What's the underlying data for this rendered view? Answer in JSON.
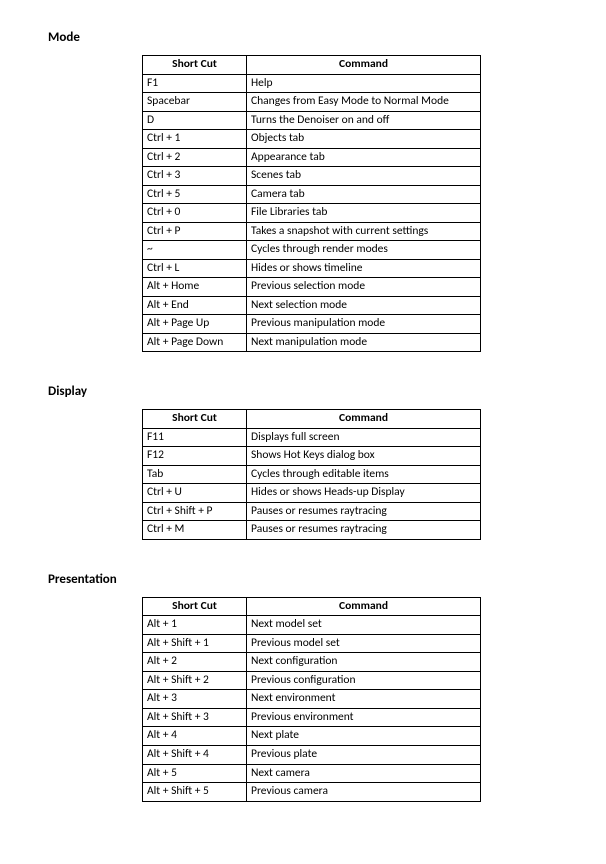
{
  "sections": [
    {
      "title": "Mode",
      "headers": {
        "shortcut": "Short Cut",
        "command": "Command"
      },
      "rows": [
        {
          "shortcut": "F1",
          "command": "Help"
        },
        {
          "shortcut": "Spacebar",
          "command": "Changes from Easy Mode to Normal Mode"
        },
        {
          "shortcut": "D",
          "command": "Turns the Denoiser on and off"
        },
        {
          "shortcut": "Ctrl + 1",
          "command": "Objects tab"
        },
        {
          "shortcut": "Ctrl + 2",
          "command": "Appearance tab"
        },
        {
          "shortcut": "Ctrl + 3",
          "command": "Scenes tab"
        },
        {
          "shortcut": "Ctrl + 5",
          "command": "Camera tab"
        },
        {
          "shortcut": "Ctrl + 0",
          "command": "File Libraries tab"
        },
        {
          "shortcut": "Ctrl + P",
          "command": "Takes a snapshot with current settings"
        },
        {
          "shortcut": "~",
          "command": "Cycles through render modes"
        },
        {
          "shortcut": "Ctrl + L",
          "command": "Hides or shows timeline"
        },
        {
          "shortcut": "Alt + Home",
          "command": "Previous selection mode"
        },
        {
          "shortcut": "Alt + End",
          "command": "Next selection mode"
        },
        {
          "shortcut": "Alt + Page Up",
          "command": "Previous manipulation mode"
        },
        {
          "shortcut": "Alt + Page Down",
          "command": "Next manipulation mode"
        }
      ]
    },
    {
      "title": "Display",
      "headers": {
        "shortcut": "Short Cut",
        "command": "Command"
      },
      "rows": [
        {
          "shortcut": "F11",
          "command": "Displays full screen"
        },
        {
          "shortcut": "F12",
          "command": "Shows Hot Keys dialog box"
        },
        {
          "shortcut": "Tab",
          "command": "Cycles through editable items"
        },
        {
          "shortcut": "Ctrl + U",
          "command": "Hides or shows Heads-up Display"
        },
        {
          "shortcut": "Ctrl + Shift + P",
          "command": "Pauses or resumes raytracing"
        },
        {
          "shortcut": "Ctrl + M",
          "command": "Pauses or resumes raytracing"
        }
      ]
    },
    {
      "title": "Presentation",
      "headers": {
        "shortcut": "Short Cut",
        "command": "Command"
      },
      "rows": [
        {
          "shortcut": "Alt + 1",
          "command": "Next model set"
        },
        {
          "shortcut": "Alt + Shift + 1",
          "command": "Previous model set"
        },
        {
          "shortcut": "Alt + 2",
          "command": "Next configuration"
        },
        {
          "shortcut": "Alt + Shift + 2",
          "command": "Previous configuration"
        },
        {
          "shortcut": "Alt + 3",
          "command": "Next environment"
        },
        {
          "shortcut": "Alt + Shift + 3",
          "command": "Previous environment"
        },
        {
          "shortcut": "Alt + 4",
          "command": "Next plate"
        },
        {
          "shortcut": "Alt + Shift + 4",
          "command": "Previous plate"
        },
        {
          "shortcut": "Alt + 5",
          "command": "Next camera"
        },
        {
          "shortcut": "Alt + Shift + 5",
          "command": "Previous camera"
        }
      ]
    }
  ]
}
